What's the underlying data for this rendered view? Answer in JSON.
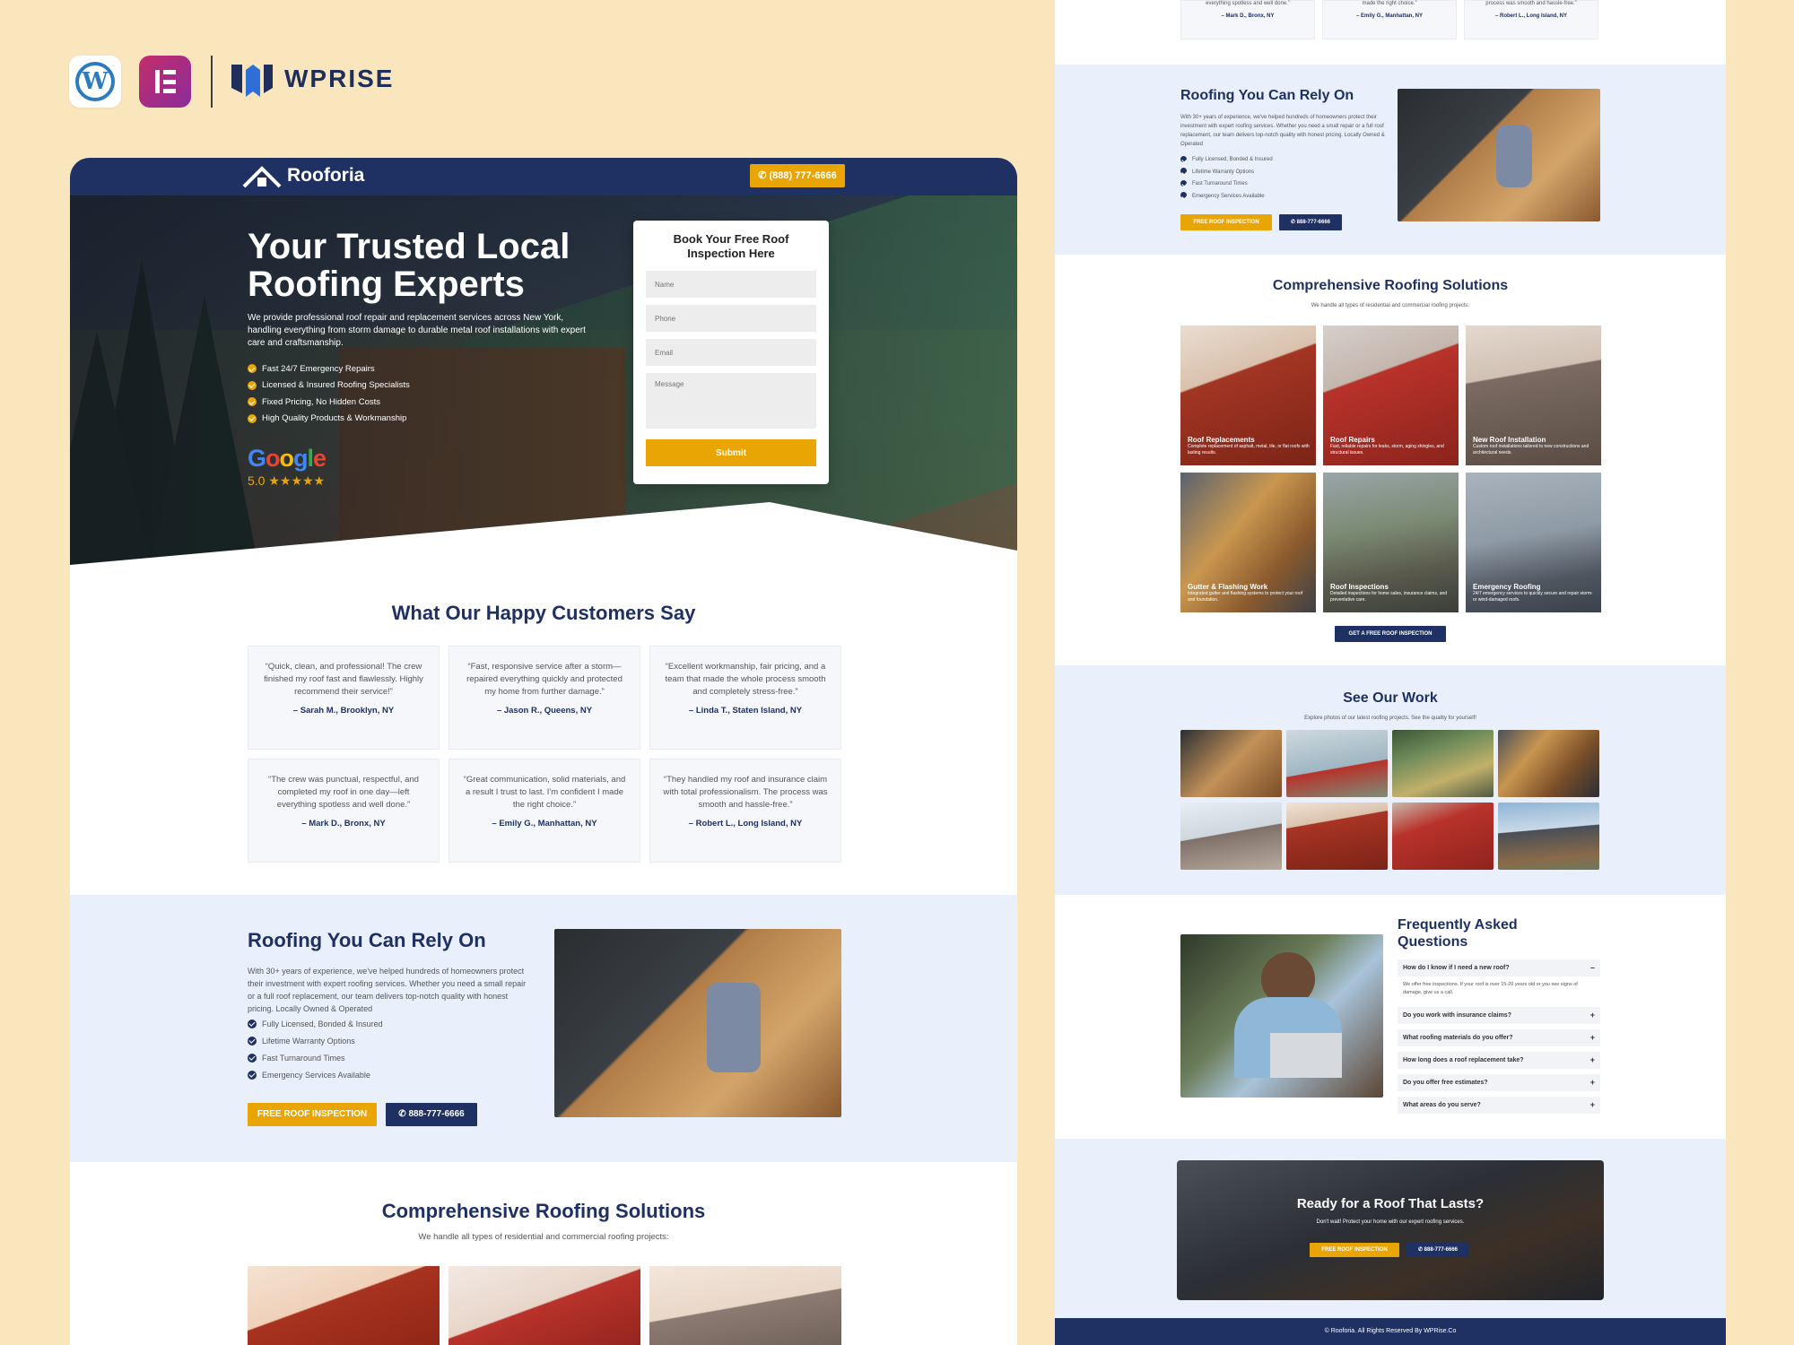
{
  "brand": {
    "name": "WPRISE",
    "icons": [
      "wordpress-icon",
      "elementor-icon",
      "wprise-logo"
    ]
  },
  "site": {
    "name": "Rooforia",
    "phone": "(888) 777-6666"
  },
  "hero": {
    "title": "Your Trusted Local Roofing Experts",
    "description": "We provide professional roof repair and replacement services across New York, handling everything from storm damage to durable metal roof installations with expert care and craftsmanship.",
    "features": [
      "Fast 24/7 Emergency Repairs",
      "Licensed & Insured Roofing Specialists",
      "Fixed Pricing, No Hidden Costs",
      "High Quality Products & Workmanship"
    ],
    "google_label": "Google",
    "rating": "5.0 ★★★★★"
  },
  "form": {
    "title": "Book Your Free Roof Inspection Here",
    "name_placeholder": "Name",
    "phone_placeholder": "Phone",
    "email_placeholder": "Email",
    "message_placeholder": "Message",
    "submit": "Submit"
  },
  "testimonials": {
    "title": "What Our Happy Customers Say",
    "items": [
      {
        "quote": "“Quick, clean, and professional! The crew finished my roof fast and flawlessly. Highly recommend their service!”",
        "author": "– Sarah M., Brooklyn, NY"
      },
      {
        "quote": "“Fast, responsive service after a storm—repaired everything quickly and protected my home from further damage.”",
        "author": "– Jason R., Queens, NY"
      },
      {
        "quote": "“Excellent workmanship, fair pricing, and a team that made the whole process smooth and completely stress-free.”",
        "author": "– Linda T., Staten Island, NY"
      },
      {
        "quote": "“The crew was punctual, respectful, and completed my roof in one day—left everything spotless and well done.”",
        "author": "– Mark D., Bronx, NY"
      },
      {
        "quote": "“Great communication, solid materials, and a result I trust to last. I'm confident I made the right choice.”",
        "author": "– Emily G., Manhattan, NY"
      },
      {
        "quote": "“They handled my roof and insurance claim with total professionalism. The process was smooth and hassle-free.”",
        "author": "– Robert L., Long Island, NY"
      }
    ],
    "right_partial_authors": [
      "– Mark D., Bronx, NY",
      "– Emily G., Manhattan, NY",
      "– Robert L., Long Island, NY"
    ],
    "right_partial_quotes": [
      "everything spotless and well done.”",
      "made the right choice.”",
      "process was smooth and hassle-free.”"
    ]
  },
  "rely": {
    "title": "Roofing You Can Rely On",
    "description": "With 30+ years of experience, we've helped hundreds of homeowners protect their investment with expert roofing services. Whether you need a small repair or a full roof replacement, our team delivers top-notch quality with honest pricing. Locally Owned & Operated",
    "features": [
      "Fully Licensed, Bonded & Insured",
      "Lifetime Warranty Options",
      "Fast Turnaround Times",
      "Emergency Services Available"
    ],
    "cta_inspection": "FREE ROOF INSPECTION",
    "cta_phone": "888-777-6666"
  },
  "solutions": {
    "title": "Comprehensive Roofing Solutions",
    "subtitle": "We handle all types of residential and commercial roofing projects:",
    "items": [
      {
        "title": "Roof Replacements",
        "desc": "Complete replacement of asphalt, metal, tile, or flat roofs with lasting results."
      },
      {
        "title": "Roof Repairs",
        "desc": "Fast, reliable repairs for leaks, storm, aging shingles, and structural issues."
      },
      {
        "title": "New Roof Installation",
        "desc": "Custom roof installations tailored to new constructions and architectural needs."
      },
      {
        "title": "Gutter & Flashing Work",
        "desc": "Integrated gutter and flashing systems to protect your roof and foundation."
      },
      {
        "title": "Roof Inspections",
        "desc": "Detailed inspections for home sales, insurance claims, and preventative care."
      },
      {
        "title": "Emergency Roofing",
        "desc": "24/7 emergency services to quickly secure and repair storm- or wind-damaged roofs."
      }
    ],
    "cta": "GET A FREE ROOF INSPECTION"
  },
  "work": {
    "title": "See Our Work",
    "subtitle": "Explore photos of our latest roofing projects. See the quality for yourself!"
  },
  "faq": {
    "title": "Frequently Asked Questions",
    "items": [
      {
        "q": "How do I know if I need a new roof?",
        "a": "We offer free inspections. If your roof is over 15-20 years old or you see signs of damage, give us a call.",
        "open": true
      },
      {
        "q": "Do you work with insurance claims?",
        "open": false
      },
      {
        "q": "What roofing materials do you offer?",
        "open": false
      },
      {
        "q": "How long does a roof replacement take?",
        "open": false
      },
      {
        "q": "Do you offer free estimates?",
        "open": false
      },
      {
        "q": "What areas do you serve?",
        "open": false
      }
    ]
  },
  "cta": {
    "title": "Ready for a Roof That Lasts?",
    "subtitle": "Don't wait! Protect your home with our expert roofing services.",
    "btn1": "FREE ROOF INSPECTION",
    "btn2": "888-777-6666"
  },
  "footer": {
    "text": "© Rooforia. All Rights Reserved By  WPRise.Co"
  },
  "colors": {
    "navy": "#1f3063",
    "accent": "#e9a504",
    "page_bg": "#f9e6bd",
    "section_tint": "#eaf0fb"
  }
}
